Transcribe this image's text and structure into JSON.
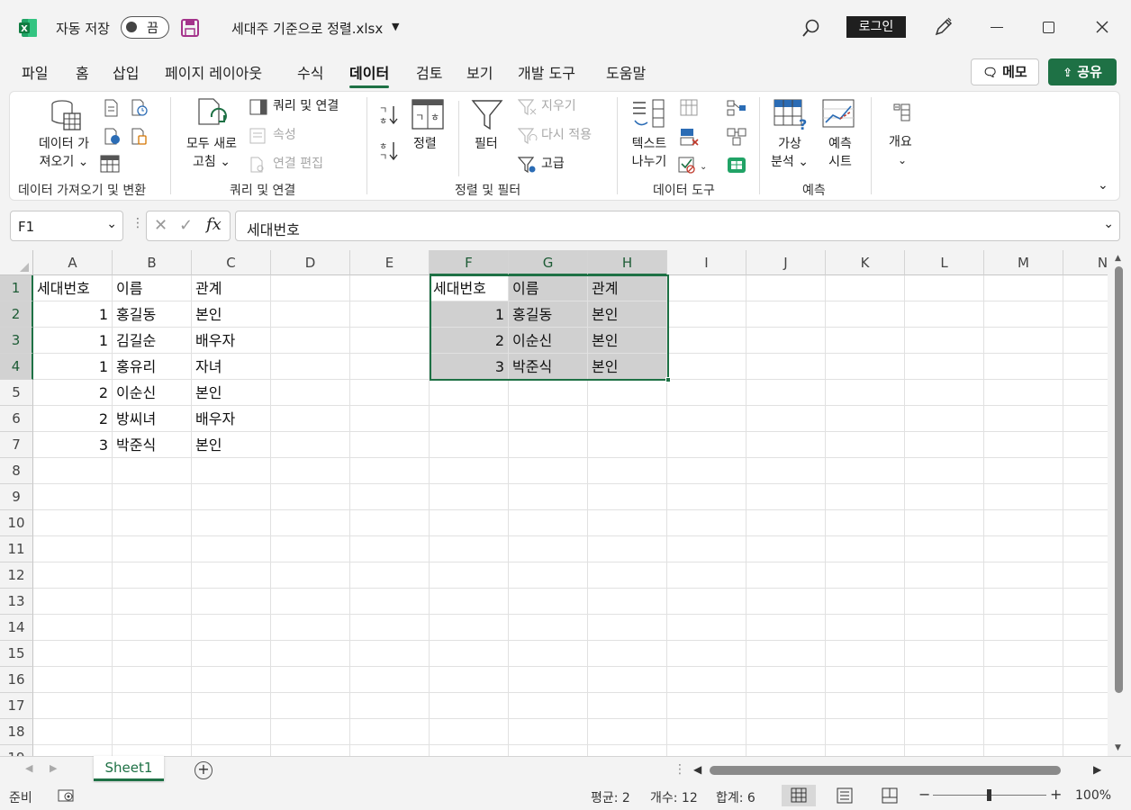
{
  "titlebar": {
    "autosave_label": "자동 저장",
    "autosave_state": "끔",
    "filename": "세대주 기준으로 정렬.xlsx",
    "login_label": "로그인"
  },
  "tabs": [
    "파일",
    "홈",
    "삽입",
    "페이지 레이아웃",
    "수식",
    "데이터",
    "검토",
    "보기",
    "개발 도구",
    "도움말"
  ],
  "active_tab": "데이터",
  "actions": {
    "memo": "메모",
    "share": "공유"
  },
  "ribbon": {
    "get_data": [
      "데이터 가",
      "져오기 ⌄"
    ],
    "refresh_all": [
      "모두 새로",
      "고침 ⌄"
    ],
    "queries_connections": "쿼리 및 연결",
    "properties": "속성",
    "edit_links": "연결 편집",
    "sort": "정렬",
    "filter": "필터",
    "clear": "지우기",
    "reapply": "다시 적용",
    "advanced": "고급",
    "text_to_columns": [
      "텍스트",
      "나누기"
    ],
    "what_if": [
      "가상",
      "분석 ⌄"
    ],
    "forecast_sheet": [
      "예측",
      "시트"
    ],
    "outline": "개요",
    "groups": [
      "데이터 가져오기 및 변환",
      "쿼리 및 연결",
      "정렬 및 필터",
      "데이터 도구",
      "예측"
    ]
  },
  "formula_bar": {
    "name_box": "F1",
    "fx": "fx",
    "content": "세대번호"
  },
  "columns": [
    "A",
    "B",
    "C",
    "D",
    "E",
    "F",
    "G",
    "H",
    "I",
    "J",
    "K",
    "L",
    "M",
    "N"
  ],
  "rows": [
    "1",
    "2",
    "3",
    "4",
    "5",
    "6",
    "7",
    "8",
    "9",
    "10",
    "11",
    "12",
    "13",
    "14",
    "15",
    "16",
    "17",
    "18",
    "19"
  ],
  "table_left": {
    "header": [
      "세대번호",
      "이름",
      "관계"
    ],
    "rows": [
      [
        "1",
        "홍길동",
        "본인"
      ],
      [
        "1",
        "김길순",
        "배우자"
      ],
      [
        "1",
        "홍유리",
        "자녀"
      ],
      [
        "2",
        "이순신",
        "본인"
      ],
      [
        "2",
        "방씨녀",
        "배우자"
      ],
      [
        "3",
        "박준식",
        "본인"
      ]
    ]
  },
  "table_right": {
    "header": [
      "세대번호",
      "이름",
      "관계"
    ],
    "rows": [
      [
        "1",
        "홍길동",
        "본인"
      ],
      [
        "2",
        "이순신",
        "본인"
      ],
      [
        "3",
        "박준식",
        "본인"
      ]
    ]
  },
  "sheet": {
    "tab_name": "Sheet1"
  },
  "status": {
    "ready": "준비",
    "average": "평균: 2",
    "count": "개수: 12",
    "sum": "합계: 6",
    "zoom": "100%"
  }
}
